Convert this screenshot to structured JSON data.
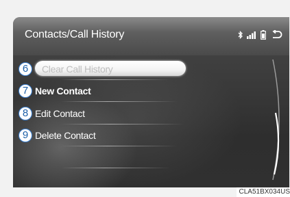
{
  "header": {
    "title": "Contacts/Call History",
    "icons": [
      "bluetooth-icon",
      "signal-icon",
      "battery-icon",
      "back-icon"
    ]
  },
  "menu": {
    "items": [
      {
        "number": "6",
        "label": "Clear Call History",
        "state": "disabled-highlighted"
      },
      {
        "number": "7",
        "label": "New Contact"
      },
      {
        "number": "8",
        "label": "Edit Contact"
      },
      {
        "number": "9",
        "label": "Delete Contact"
      }
    ]
  },
  "caption": "CLA51BX034US",
  "colors": {
    "callout_border": "#3a7fd0",
    "callout_text": "#1c5fa8",
    "screen_bg": "#3a3a3a"
  }
}
